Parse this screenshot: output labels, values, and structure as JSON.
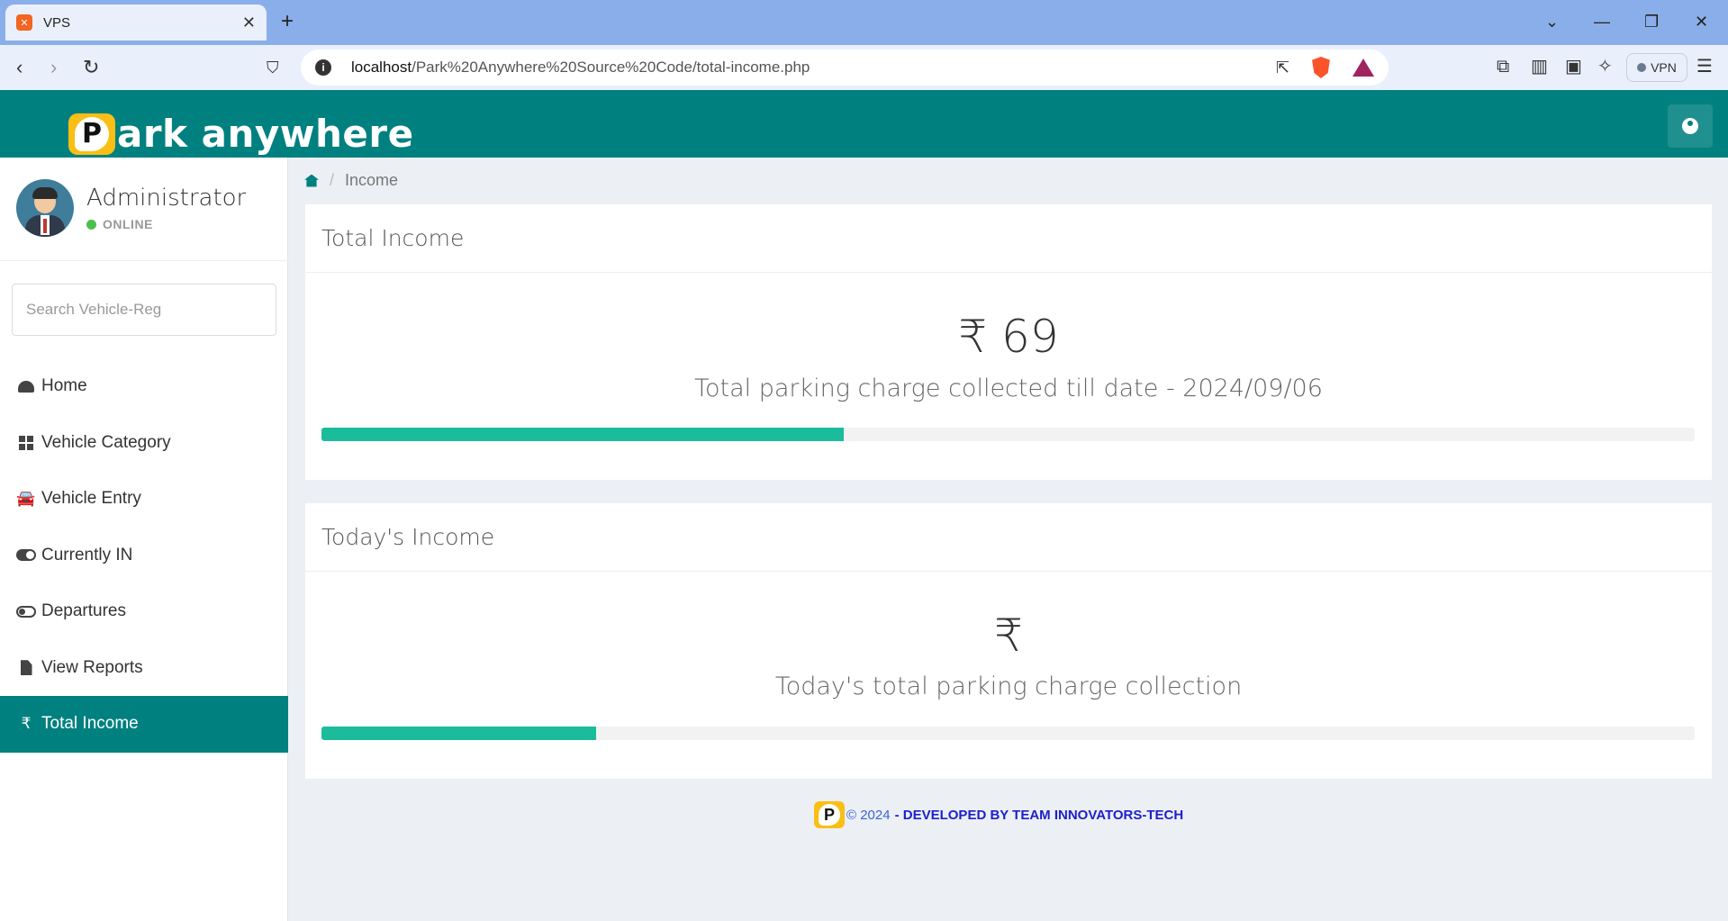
{
  "browser": {
    "tab_title": "VPS",
    "tab_favicon": "xampp-icon",
    "url_host": "localhost",
    "url_path": "/Park%20Anywhere%20Source%20Code/total-income.php",
    "vpn_label": "VPN"
  },
  "header": {
    "logo_letter": "P",
    "logo_text": "ark anywhere",
    "brand_color": "#018080",
    "logo_accent": "#f9bf15"
  },
  "profile": {
    "name": "Administrator",
    "status": "ONLINE"
  },
  "search": {
    "placeholder": "Search Vehicle-Reg"
  },
  "sidebar": {
    "items": [
      {
        "label": "Home",
        "icon": "dashboard-icon"
      },
      {
        "label": "Vehicle Category",
        "icon": "grid-icon"
      },
      {
        "label": "Vehicle Entry",
        "icon": "car-icon"
      },
      {
        "label": "Currently IN",
        "icon": "toggle-on-icon"
      },
      {
        "label": "Departures",
        "icon": "toggle-off-icon"
      },
      {
        "label": "View Reports",
        "icon": "file-icon"
      },
      {
        "label": "Total Income",
        "icon": "rupee-icon",
        "active": true
      }
    ]
  },
  "breadcrumb": {
    "current": "Income"
  },
  "total_income": {
    "title": "Total Income",
    "value": "₹ 69",
    "caption": "Total parking charge collected till date - 2024/09/06",
    "progress_percent": 38
  },
  "today_income": {
    "title": "Today's Income",
    "value": "₹",
    "caption": "Today's total parking charge collection",
    "progress_percent": 20
  },
  "footer": {
    "logo_letter": "P",
    "copyright": "© 2024",
    "developer": "- DEVELOPED BY TEAM INNOVATORS-TECH"
  }
}
